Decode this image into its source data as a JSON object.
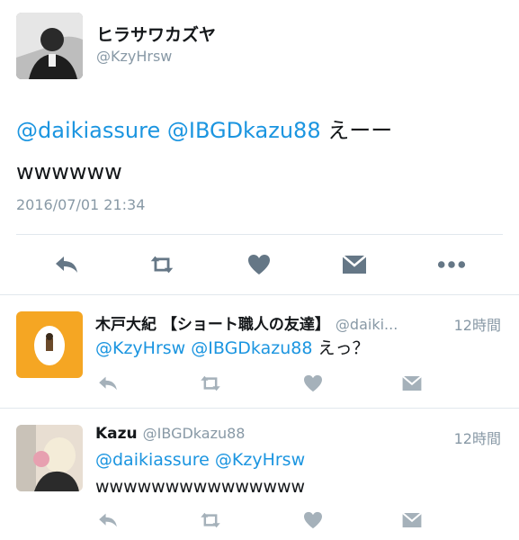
{
  "main_tweet": {
    "display_name": "ヒラサワカズヤ",
    "handle": "@KzyHrsw",
    "mention_1": "@daikiassure",
    "mention_2": "@IBGDkazu88",
    "text_1": " えーー",
    "text_2": "wwwwww",
    "timestamp": "2016/07/01 21:34"
  },
  "replies": [
    {
      "display_name": "木戸大紀 【ショート職人の友達】",
      "handle": "@daiki...",
      "time": "12時間",
      "mention_1": "@KzyHrsw",
      "mention_2": "@IBGDkazu88",
      "text": " えっ？"
    },
    {
      "display_name": "Kazu",
      "handle": "@IBGDkazu88",
      "time": "12時間",
      "mention_1": "@daikiassure",
      "mention_2": "@KzyHrsw",
      "text": "wwwwwwwwwwwwwww"
    }
  ],
  "icons": {
    "reply": "reply-arrow-icon",
    "retweet": "retweet-icon",
    "like": "heart-icon",
    "dm": "envelope-icon",
    "more": "more-dots-icon"
  },
  "colors": {
    "mention": "#1b95e0",
    "secondary": "#8899a6",
    "icon": "#657786",
    "icon_small": "#a5b1ba",
    "divider": "#e1e8ed"
  }
}
